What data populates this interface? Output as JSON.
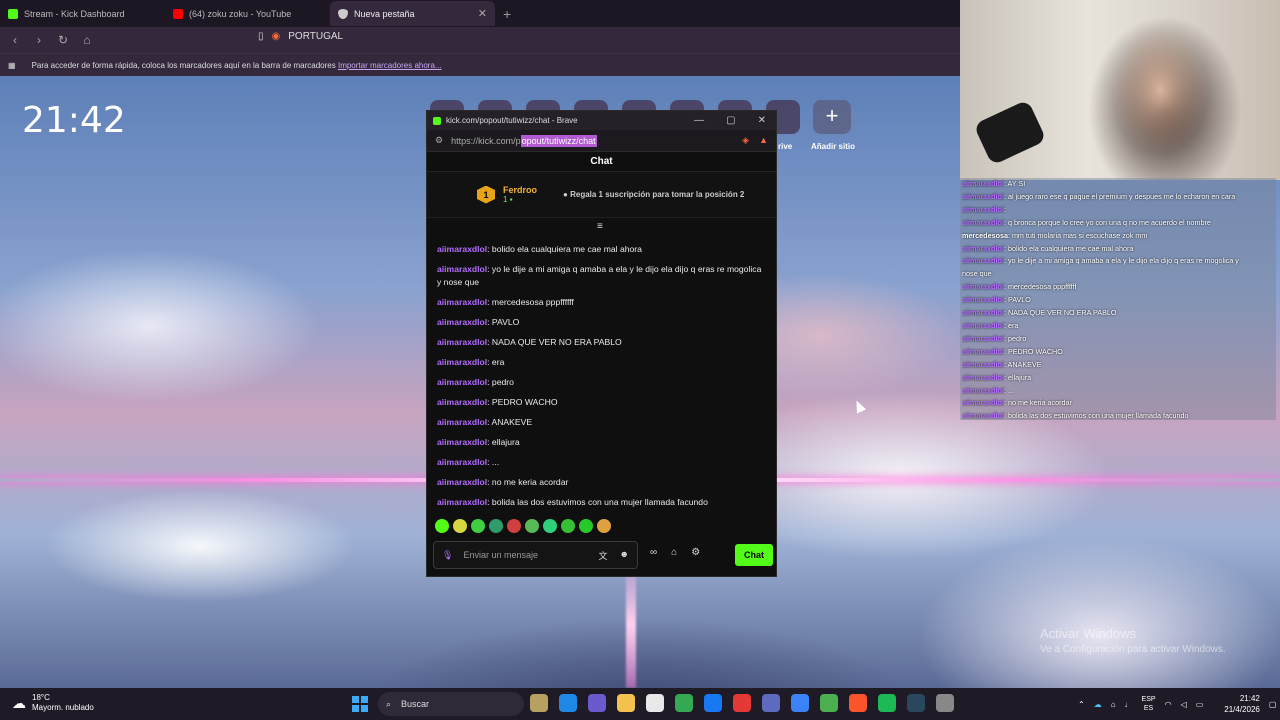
{
  "browser": {
    "tabs": [
      {
        "title": "Stream - Kick Dashboard",
        "icon": "kick-icon",
        "color": "#53fc18"
      },
      {
        "title": "(64) zoku zoku - YouTube",
        "icon": "youtube-icon",
        "color": "#ff0000"
      },
      {
        "title": "Nueva pestaña",
        "icon": "shield-icon",
        "color": "#cccccc"
      }
    ],
    "address": "PORTUGAL",
    "bookmarks_hint": "Para acceder de forma rápida, coloca los marcadores aquí en la barra de marcadores",
    "bookmarks_link": "Importar marcadores ahora..."
  },
  "desktop": {
    "clock": "21:42",
    "shortcut_partial_label": "rive",
    "add_site_label": "Añadir sitio",
    "watermark_title": "Activar Windows",
    "watermark_sub": "Ve a Configuración para activar Windows."
  },
  "popout": {
    "window_title": "kick.com/popout/tutiwizz/chat - Brave",
    "url_prefix": "https://kick.com/p",
    "url_selected": "opout/tutiwizz/chat",
    "header": "Chat",
    "pinned": {
      "rank": "1",
      "user": "Ferdroo",
      "count": "1",
      "text": "Regala 1 suscripción para tomar la posición 2"
    },
    "messages": [
      {
        "user": "aiimaraxdlol",
        "text": ": bolido ela cualquiera me cae mal ahora"
      },
      {
        "user": "aiimaraxdlol",
        "text": ": yo le dije a mi amiga q amaba a ela y le dijo ela dijo q eras re mogolica y nose que"
      },
      {
        "user": "aiimaraxdlol",
        "text": ": mercedesosa pppffffff"
      },
      {
        "user": "aiimaraxdlol",
        "text": ": PAVLO"
      },
      {
        "user": "aiimaraxdlol",
        "text": ": NADA QUE VER NO ERA PABLO"
      },
      {
        "user": "aiimaraxdlol",
        "text": ": era"
      },
      {
        "user": "aiimaraxdlol",
        "text": ": pedro"
      },
      {
        "user": "aiimaraxdlol",
        "text": ": PEDRO WACHO"
      },
      {
        "user": "aiimaraxdlol",
        "text": ": ANAKEVE"
      },
      {
        "user": "aiimaraxdlol",
        "text": ": ellajura"
      },
      {
        "user": "aiimaraxdlol",
        "text": ": ..."
      },
      {
        "user": "aiimaraxdlol",
        "text": ": no me keria acordar"
      },
      {
        "user": "aiimaraxdlol",
        "text": ": bolida las dos estuvimos con una mujer llamada facundo"
      }
    ],
    "emote_colors": [
      "#53fc18",
      "#d6d640",
      "#3fcf3f",
      "#2e9c6a",
      "#d04040",
      "#58b858",
      "#2fd07a",
      "#35c035",
      "#28c828",
      "#e0a040"
    ],
    "input_placeholder": "Enviar un mensaje",
    "send_label": "Chat"
  },
  "overlay": {
    "messages": [
      {
        "user": "aiimaraxdlol",
        "text": ": AY SI",
        "style": "purple"
      },
      {
        "user": "aiimaraxdlol",
        "text": ": al juego raro ese q pague el premium y despues me lo echaron en cara",
        "style": "purple"
      },
      {
        "user": "aiimaraxdlol",
        "text": ":",
        "style": "purple"
      },
      {
        "user": "aiimaraxdlol",
        "text": ": q bronca porque lo cree yo con una q no me acuerdo el nombre",
        "style": "purple"
      },
      {
        "user": "mercedesosa",
        "text": ": mm tuti molaria mas si escuchase zok mm",
        "style": "white"
      },
      {
        "user": "aiimaraxdlol",
        "text": ": bolido ela cualquiera me cae mal ahora",
        "style": "purple"
      },
      {
        "user": "aiimaraxdlol",
        "text": ": yo le dije a mi amiga q amaba a ela y le dijo ela dijo q eras re mogolica y",
        "style": "purple"
      },
      {
        "user": "",
        "text": "nose que",
        "style": "purple"
      },
      {
        "user": "aiimaraxdlol",
        "text": ": mercedesosa pppffffff",
        "style": "purple"
      },
      {
        "user": "aiimaraxdlol",
        "text": ": PAVLO",
        "style": "purple"
      },
      {
        "user": "aiimaraxdlol",
        "text": ": NADA QUE VER NO ERA PABLO",
        "style": "purple"
      },
      {
        "user": "aiimaraxdlol",
        "text": ": era",
        "style": "purple"
      },
      {
        "user": "aiimaraxdlol",
        "text": ": pedro",
        "style": "purple"
      },
      {
        "user": "aiimaraxdlol",
        "text": ": PEDRO WACHO",
        "style": "purple"
      },
      {
        "user": "aiimaraxdlol",
        "text": ": ANAKEVE",
        "style": "purple"
      },
      {
        "user": "aiimaraxdlol",
        "text": ": ellajura",
        "style": "purple"
      },
      {
        "user": "aiimaraxdlol",
        "text": ": ...",
        "style": "purple"
      },
      {
        "user": "aiimaraxdlol",
        "text": ": no me keria acordar",
        "style": "purple"
      },
      {
        "user": "aiimaraxdlol",
        "text": ": bolida las dos estuvimos con una mujer llamada facundo",
        "style": "purple"
      }
    ]
  },
  "taskbar": {
    "temp": "18°C",
    "weather": "Mayorm. nublado",
    "search": "Buscar",
    "app_colors": [
      "#b8a060",
      "#1e88e5",
      "#6a5acd",
      "#f2c14e",
      "#e8e8e8",
      "#34a853",
      "#1877f2",
      "#e53935",
      "#5c6bc0",
      "#3b82f6",
      "#4caf50",
      "#fb542b",
      "#1db954",
      "#2a475e",
      "#888888"
    ],
    "lang1": "ESP",
    "lang2": "ES",
    "time": "21:42",
    "date": "21/4/2026"
  }
}
